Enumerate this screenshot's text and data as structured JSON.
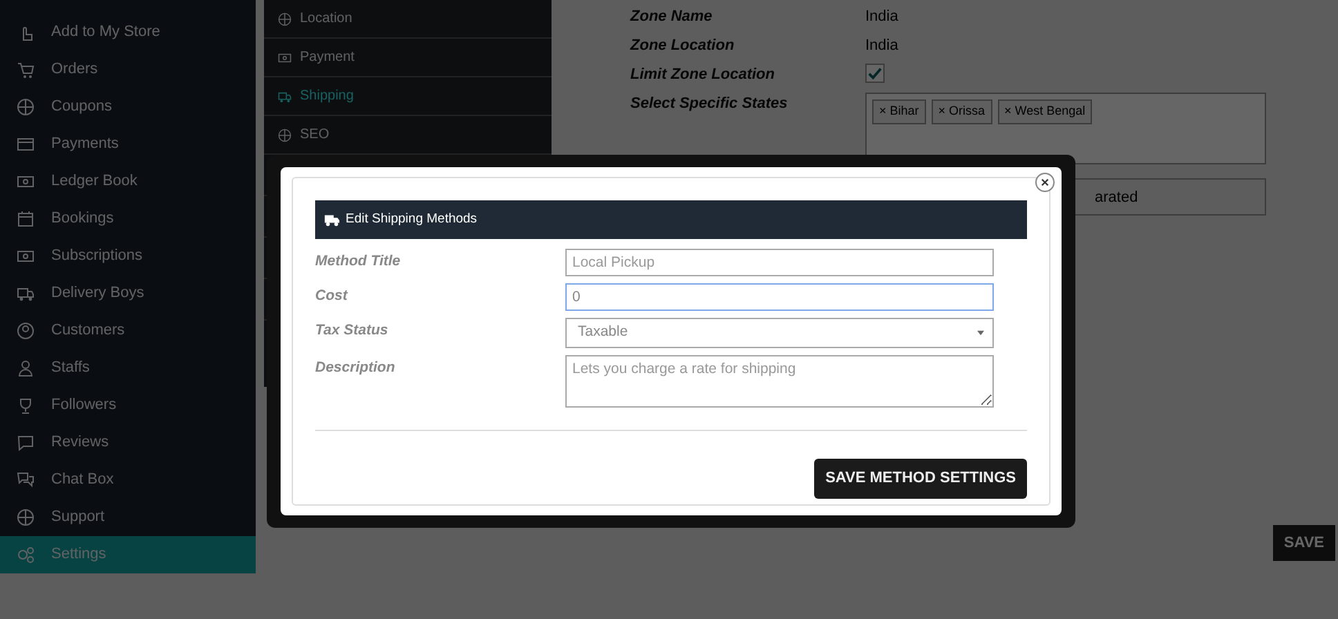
{
  "sidebar": {
    "items": [
      {
        "label": "Add to My Store",
        "selected": false
      },
      {
        "label": "Orders",
        "selected": false
      },
      {
        "label": "Coupons",
        "selected": false
      },
      {
        "label": "Payments",
        "selected": false
      },
      {
        "label": "Ledger Book",
        "selected": false
      },
      {
        "label": "Bookings",
        "selected": false
      },
      {
        "label": "Subscriptions",
        "selected": false
      },
      {
        "label": "Delivery Boys",
        "selected": false
      },
      {
        "label": "Customers",
        "selected": false
      },
      {
        "label": "Staffs",
        "selected": false
      },
      {
        "label": "Followers",
        "selected": false
      },
      {
        "label": "Reviews",
        "selected": false
      },
      {
        "label": "Chat Box",
        "selected": false
      },
      {
        "label": "Support",
        "selected": false
      },
      {
        "label": "Settings",
        "selected": true
      }
    ]
  },
  "settings_menu": {
    "items": [
      {
        "label": "Location",
        "selected": false
      },
      {
        "label": "Payment",
        "selected": false
      },
      {
        "label": "Shipping",
        "selected": true
      },
      {
        "label": "SEO",
        "selected": false
      }
    ]
  },
  "zone_form": {
    "fields": [
      {
        "kind": "text",
        "label": "Zone Name",
        "value": "India"
      },
      {
        "kind": "text",
        "label": "Zone Location",
        "value": "India"
      },
      {
        "kind": "checkbox",
        "label": "Limit Zone Location",
        "checked": true
      },
      {
        "kind": "tags",
        "label": "Select Specific States",
        "tags": [
          "× Bihar",
          "× Orissa",
          "× West Bengal"
        ]
      }
    ],
    "partial_field": {
      "value": "arated"
    }
  },
  "save_button": "SAVE",
  "modal": {
    "title": "Edit Shipping Methods",
    "fields": [
      {
        "kind": "text",
        "label": "Method Title",
        "placeholder": "Local Pickup",
        "focused": false
      },
      {
        "kind": "number",
        "label": "Cost",
        "value": "0",
        "focused": true
      },
      {
        "kind": "select",
        "label": "Tax Status",
        "value": "Taxable",
        "focused": false
      },
      {
        "kind": "textarea",
        "label": "Description",
        "placeholder": "Lets you charge a rate for shipping",
        "focused": false
      }
    ],
    "submit": "SAVE METHOD SETTINGS"
  }
}
